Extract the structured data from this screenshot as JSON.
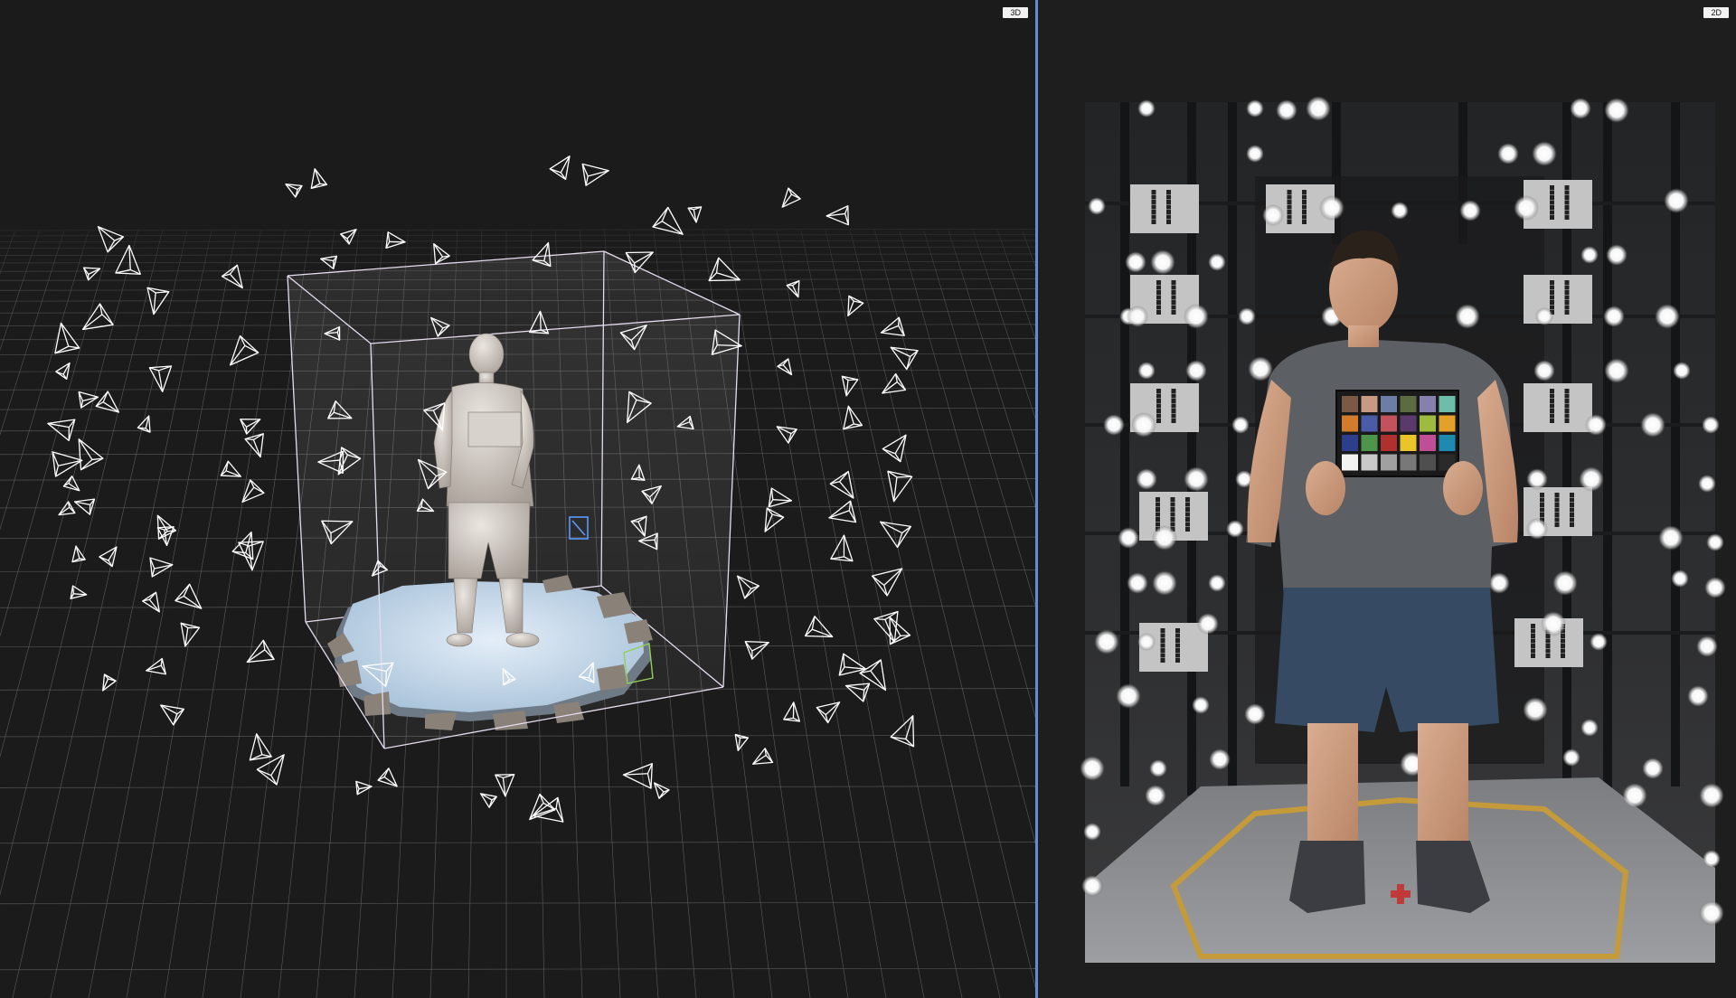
{
  "viewports": {
    "left": {
      "mode_label": "3D"
    },
    "right": {
      "mode_label": "2D"
    }
  },
  "colors": {
    "background": "#1b1b1b",
    "divider": "#5b8fd6",
    "grid": "#6a6a6a",
    "bounding_box": "#e8e0f0",
    "model": "#cfc7c0",
    "turntable": "#c8dcef",
    "camera_frustum": "#ffffff",
    "selected_camera": "#5b9bff"
  }
}
